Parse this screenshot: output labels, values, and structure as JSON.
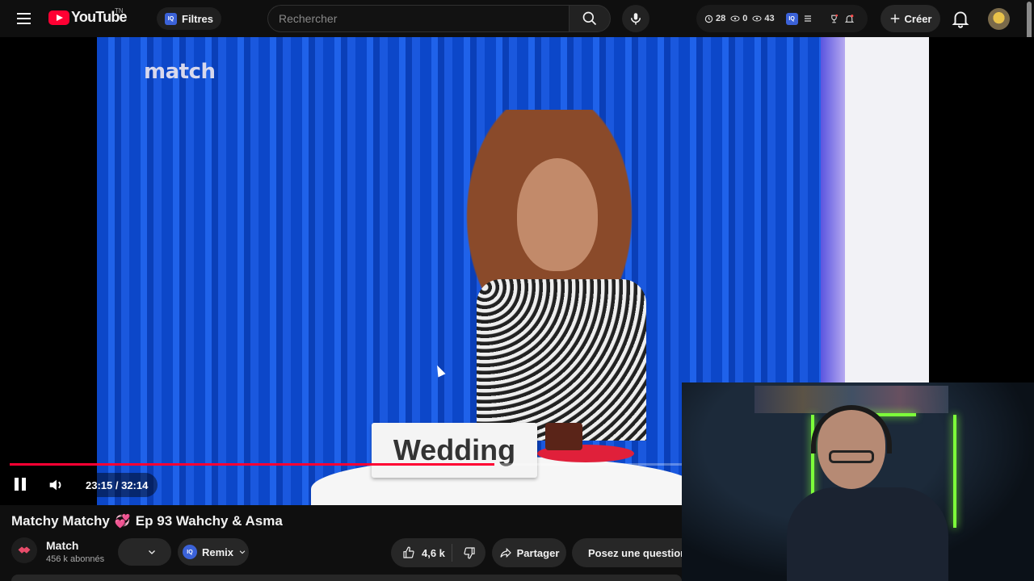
{
  "header": {
    "logo_text": "YouTube",
    "logo_country": "TN",
    "filters_label": "Filtres",
    "search_placeholder": "Rechercher",
    "stats": {
      "clock": "28",
      "eye_a": "0",
      "eye_b": "43"
    },
    "create_label": "Créer"
  },
  "video": {
    "watermark": "match",
    "placard_text": "Wedding",
    "current_time": "23:15",
    "duration": "32:14",
    "time_display": "23:15 / 32:14",
    "progress_fraction": 0.721
  },
  "details": {
    "title_part1": "Matchy Matchy",
    "title_emoji": "💞",
    "title_part2": "Ep 93 Wahchy & Asma",
    "channel_name": "Match",
    "subscribers": "456 k abonnés",
    "remix_label": "Remix",
    "like_count": "4,6 k",
    "share_label": "Partager",
    "ask_label": "Posez une question"
  },
  "colors": {
    "accent": "#ff0033",
    "background": "#0f0f0f",
    "button_bg": "#272727"
  }
}
